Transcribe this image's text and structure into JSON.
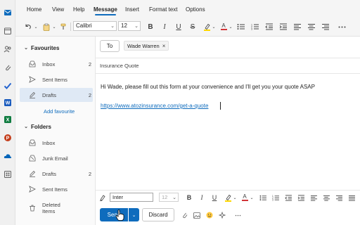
{
  "ribbon": {
    "tabs": [
      {
        "label": "Home"
      },
      {
        "label": "View"
      },
      {
        "label": "Help"
      },
      {
        "label": "Message",
        "active": true
      },
      {
        "label": "Insert"
      },
      {
        "label": "Format text"
      },
      {
        "label": "Options"
      }
    ],
    "font_name": "Calibri",
    "font_size": "12"
  },
  "rail": {
    "apps": [
      "mail-icon",
      "calendar-icon",
      "people-icon",
      "attach-icon",
      "todo-icon",
      "word-icon",
      "excel-icon",
      "powerpoint-icon",
      "onedrive-icon",
      "apps-icon"
    ]
  },
  "folders": {
    "favourites": {
      "header": "Favourites",
      "items": [
        {
          "label": "Inbox",
          "count": "2",
          "icon": "inbox-icon"
        },
        {
          "label": "Sent Items",
          "count": "",
          "icon": "send-icon"
        },
        {
          "label": "Drafts",
          "count": "2",
          "icon": "drafts-icon",
          "selected": true
        }
      ],
      "add_label": "Add favourite"
    },
    "folders": {
      "header": "Folders",
      "items": [
        {
          "label": "Inbox",
          "count": "",
          "icon": "inbox-icon"
        },
        {
          "label": "Junk Email",
          "count": "",
          "icon": "junk-icon"
        },
        {
          "label": "Drafts",
          "count": "2",
          "icon": "drafts-icon"
        },
        {
          "label": "Sent Items",
          "count": "",
          "icon": "send-icon"
        },
        {
          "label": "Deleted Items",
          "count": "",
          "icon": "trash-icon"
        }
      ]
    }
  },
  "compose": {
    "to_label": "To",
    "recipient": "Wade Warren",
    "recipient_remove": "×",
    "subject": "Insurance Quote",
    "body": "Hi Wade, please fill out this form at your convenience and I'll get you your quote ASAP",
    "link": "https://www.atozinsurance.com/get-a-quote",
    "format_font": "Inter",
    "format_size": "12",
    "send_label": "Send",
    "discard_label": "Discard"
  },
  "colors": {
    "accent": "#0f6cbd",
    "selected_folder": "#dfe9f5",
    "highlight": "#ffd700",
    "font_color": "#d13438"
  }
}
